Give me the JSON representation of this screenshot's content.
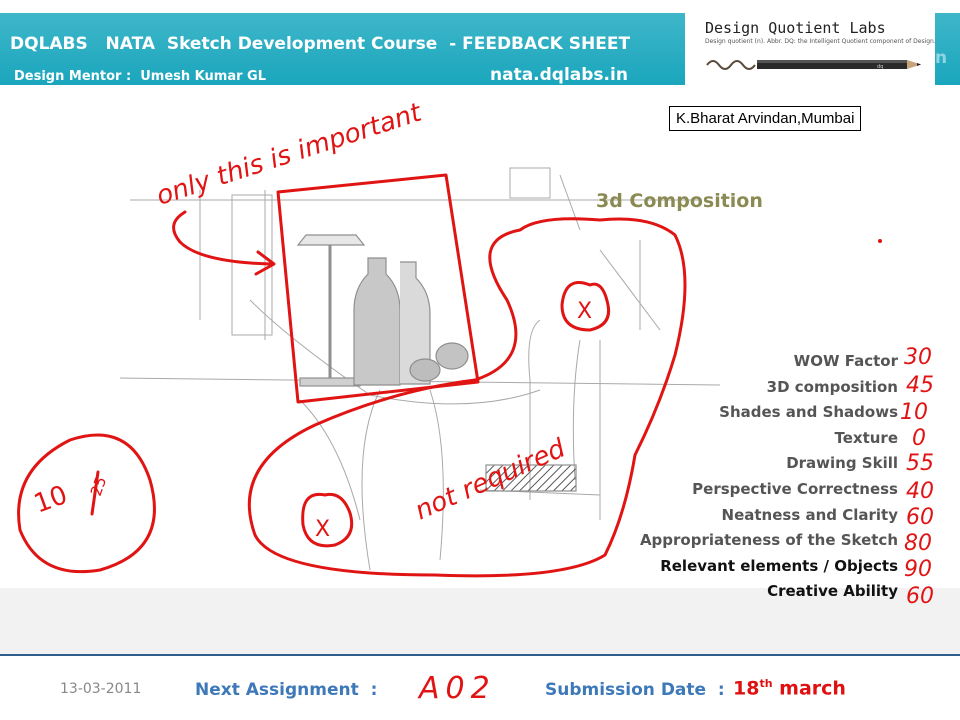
{
  "header": {
    "title": "DQLABS   NATA  Sketch Development Course  - FEEDBACK SHEET",
    "mentor": "Design Mentor :  Umesh Kumar GL",
    "website": "nata.dqlabs.in",
    "bg_color": "#1aa6bd"
  },
  "logo": {
    "title": "Design Quotient Labs",
    "tagline": "Design quotient (n). Abbr. DQ: the Intelligent Quotient component of Design."
  },
  "student": "K.Bharat Arvindan,Mumbai",
  "composition_title": "3d Composition",
  "annotations": {
    "important": "only this is important",
    "not_required": "not required",
    "cross_mark": "X",
    "total_score": "10",
    "total_out_of": "25"
  },
  "criteria": [
    {
      "label": "WOW Factor",
      "score": "30"
    },
    {
      "label": "3D composition",
      "score": "45"
    },
    {
      "label": "Shades and Shadows",
      "score": "10"
    },
    {
      "label": "Texture",
      "score": "0"
    },
    {
      "label": "Drawing Skill",
      "score": "55"
    },
    {
      "label": "Perspective Correctness",
      "score": "40"
    },
    {
      "label": "Neatness and Clarity",
      "score": "60"
    },
    {
      "label": "Appropriateness of the Sketch",
      "score": "80"
    },
    {
      "label": "Relevant elements / Objects",
      "score": "90"
    },
    {
      "label": "Creative Ability",
      "score": "60"
    }
  ],
  "footer": {
    "date": "13-03-2011",
    "next_assignment_label": "Next Assignment  :",
    "next_assignment_value": "A02",
    "submission_label": "Submission Date  :",
    "submission_day": "18",
    "submission_suffix": "th",
    "submission_month": "march"
  },
  "colors": {
    "ink": "#e11414",
    "footer_text": "#3d79b9",
    "composition_title": "#8a8a52"
  }
}
